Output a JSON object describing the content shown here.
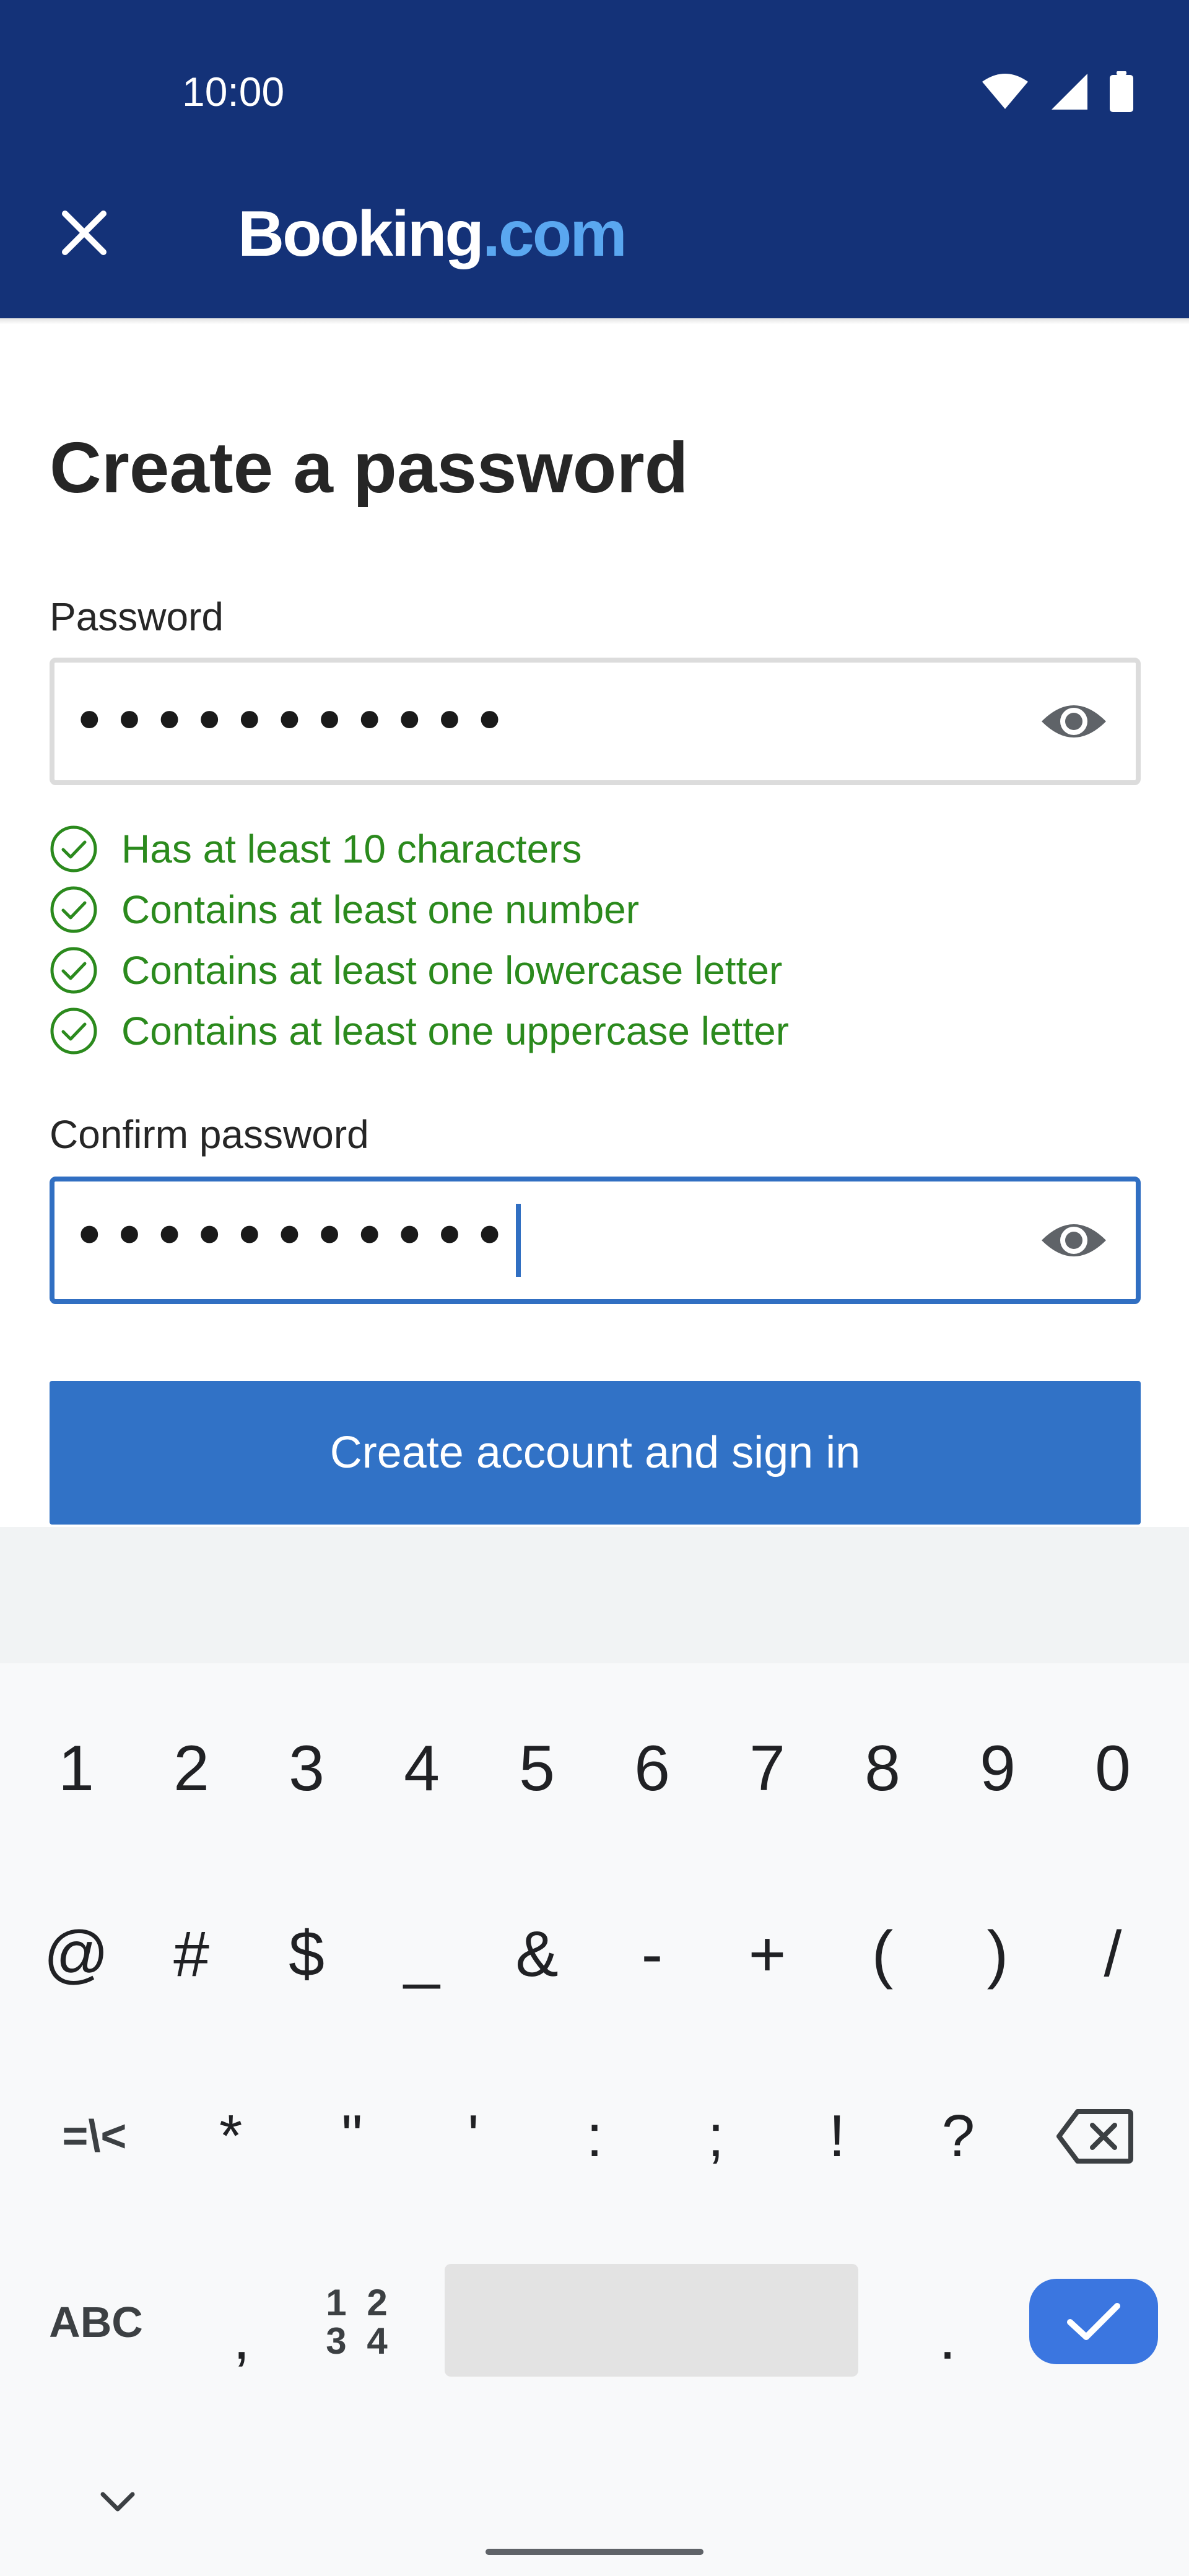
{
  "status_bar": {
    "time": "10:00",
    "icons": [
      "wifi-icon",
      "cell-signal-icon",
      "battery-icon"
    ]
  },
  "app_bar": {
    "close_icon": "close-icon",
    "brand_main": "Booking",
    "brand_suffix": ".com"
  },
  "form": {
    "title": "Create a password",
    "password": {
      "label": "Password",
      "masked_value": "•••••••••••",
      "toggle_icon": "eye-icon"
    },
    "requirements": [
      {
        "text": "Has at least 10 characters",
        "met": true
      },
      {
        "text": "Contains at least one number",
        "met": true
      },
      {
        "text": "Contains at least one lowercase letter",
        "met": true
      },
      {
        "text": "Contains at least one uppercase letter",
        "met": true
      }
    ],
    "confirm": {
      "label": "Confirm password",
      "masked_value": "•••••••••••",
      "toggle_icon": "eye-icon"
    },
    "submit_label": "Create account and sign in"
  },
  "keyboard": {
    "row1": [
      "1",
      "2",
      "3",
      "4",
      "5",
      "6",
      "7",
      "8",
      "9",
      "0"
    ],
    "row2": [
      "@",
      "#",
      "$",
      "_",
      "&",
      "-",
      "+",
      "(",
      ")",
      "/"
    ],
    "row3": [
      "=\\<",
      "*",
      "\"",
      "'",
      ":",
      ";",
      "!",
      "?"
    ],
    "abc_label": "ABC",
    "comma": ",",
    "numsym_line1": "1 2",
    "numsym_line2": "3 4",
    "period": ".",
    "icons": [
      "backspace-icon",
      "check-icon",
      "chevron-down-icon"
    ]
  },
  "colors": {
    "brand_blue": "#143278",
    "accent_blue": "#3172c6",
    "success_green": "#2b8a1d"
  }
}
